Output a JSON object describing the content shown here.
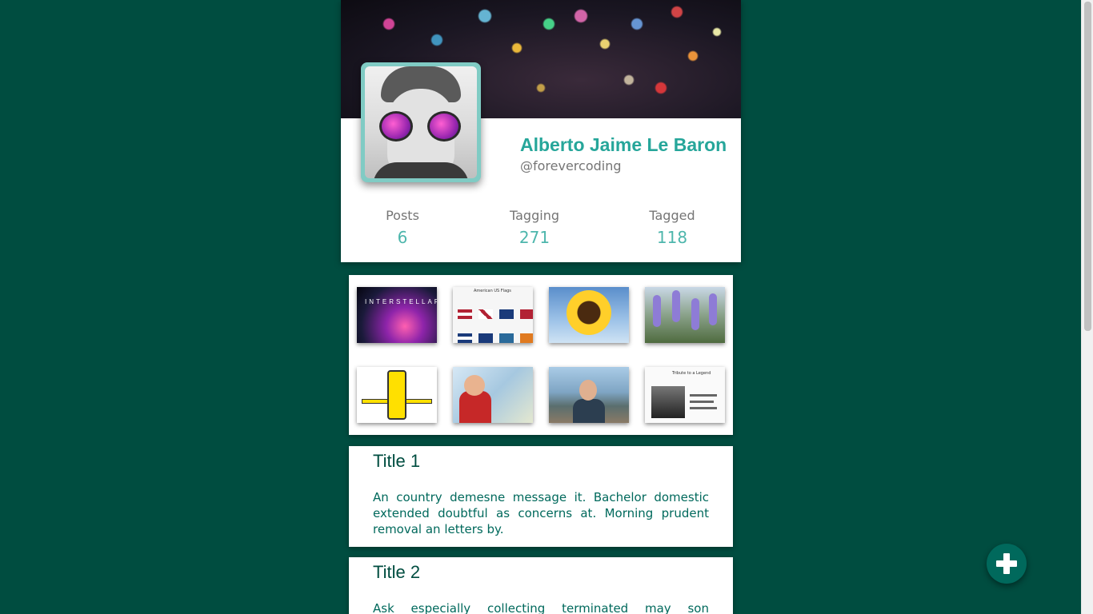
{
  "profile": {
    "name": "Alberto Jaime Le Baron",
    "handle": "@forevercoding"
  },
  "stats": [
    {
      "label": "Posts",
      "value": "6"
    },
    {
      "label": "Tagging",
      "value": "271"
    },
    {
      "label": "Tagged",
      "value": "118"
    }
  ],
  "gallery": {
    "thumbnails": [
      {
        "name": "interstellar-poster",
        "caption": "INTERSTELLAR"
      },
      {
        "name": "american-us-flags",
        "caption": "American US Flags"
      },
      {
        "name": "sunflower"
      },
      {
        "name": "purple-flowers"
      },
      {
        "name": "robot-drawing"
      },
      {
        "name": "person-photo"
      },
      {
        "name": "seaside-selfie"
      },
      {
        "name": "article-screenshot",
        "caption": "Tribute to a Legend"
      }
    ]
  },
  "posts": [
    {
      "title": "Title 1",
      "body": "An country demesne message it. Bachelor domestic extended doubtful as concerns at. Morning prudent removal an letters by."
    },
    {
      "title": "Title 2",
      "body": "Ask especially collecting terminated may son expression."
    }
  ],
  "fab": {
    "icon": "plus-icon"
  },
  "colors": {
    "background": "#004d40",
    "accent": "#26a69a",
    "stat_value": "#4db6ac",
    "fab": "#00695c"
  }
}
